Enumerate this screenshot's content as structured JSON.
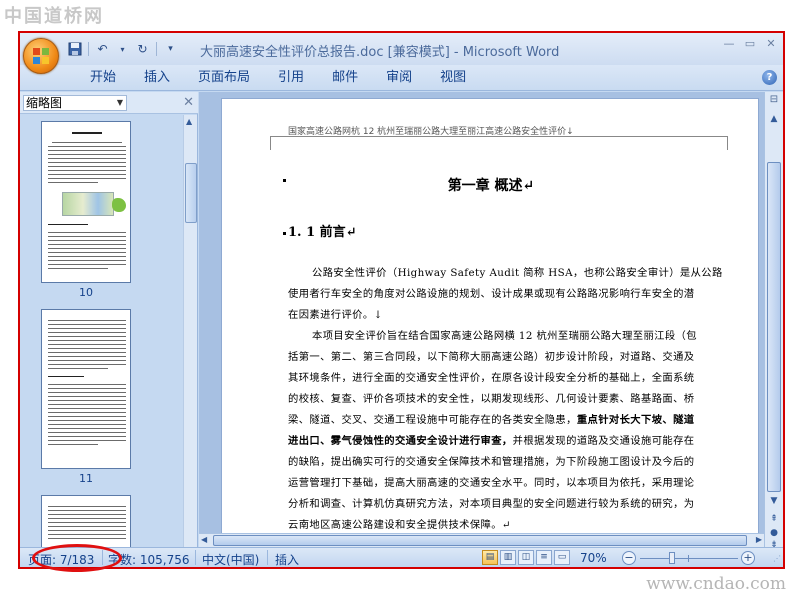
{
  "watermarks": {
    "top_left": "中国道桥网",
    "bottom_right": "www.cndao.com"
  },
  "window": {
    "title": "大丽高速安全性评价总报告.doc [兼容模式] - Microsoft Word",
    "controls": [
      "minimize-icon",
      "restore-icon",
      "close-icon"
    ]
  },
  "quick_access": {
    "icons": [
      "save-icon",
      "undo-icon",
      "redo-icon",
      "customize-icon"
    ]
  },
  "ribbon": {
    "tabs": [
      "开始",
      "插入",
      "页面布局",
      "引用",
      "邮件",
      "审阅",
      "视图"
    ]
  },
  "thumbnail_pane": {
    "view_select": "缩略图",
    "pages": [
      {
        "num": "10"
      },
      {
        "num": "11"
      }
    ]
  },
  "document": {
    "header_text": "国家高速公路网杭 12 杭州至瑞丽公路大理至丽江高速公路安全性评价↓",
    "chapter_title": "第一章  概述↵",
    "section_title": "1. 1 前言↵",
    "paragraphs": [
      "公路安全性评价（Highway Safety Audit 简称 HSA，也称公路安全审计）是从公路",
      "使用者行车安全的角度对公路设施的规划、设计成果或现有公路路况影响行车安全的潜",
      "在因素进行评价。↓",
      "本项目安全评价旨在结合国家高速公路网横 12 杭州至瑞丽公路大理至丽江段（包",
      "括第一、第二、第三合同段，以下简称大丽高速公路）初步设计阶段，对道路、交通及",
      "其环境条件，进行全面的交通安全性评价，在原各设计段安全分析的基础上，全面系统",
      "的校核、复查、评价各项技术的安全性，以期发现线形、几何设计要素、路基路面、桥",
      "梁、隧道、交叉、交通工程设施中可能存在的各类安全隐患，",
      "进出口、雾气侵蚀性的交通安全设计进行审查，",
      "的缺陷，提出确实可行的交通安全保障技术和管理措施，为下阶段施工图设计及今后的",
      "运营管理打下基础，提高大丽高速的交通安全水平。同时，以本项目为依托，采用理论",
      "分析和调查、计算机仿真研究方法，对本项目典型的安全问题进行较为系统的研究，为",
      "云南地区高速公路建设和安全提供技术保障。↵"
    ],
    "bold_fragment_1": "重点针对长大下坡、隧道",
    "bold_fragment_2": "并根据发现的道路及交通设施可能存在"
  },
  "status_bar": {
    "page": "页面: 7/183",
    "words": "字数: 105,756",
    "language": "中文(中国)",
    "mode": "插入",
    "zoom": "70%",
    "zoom_level_percent": 70
  },
  "annotation": {
    "highlight_color": "#e01010"
  }
}
